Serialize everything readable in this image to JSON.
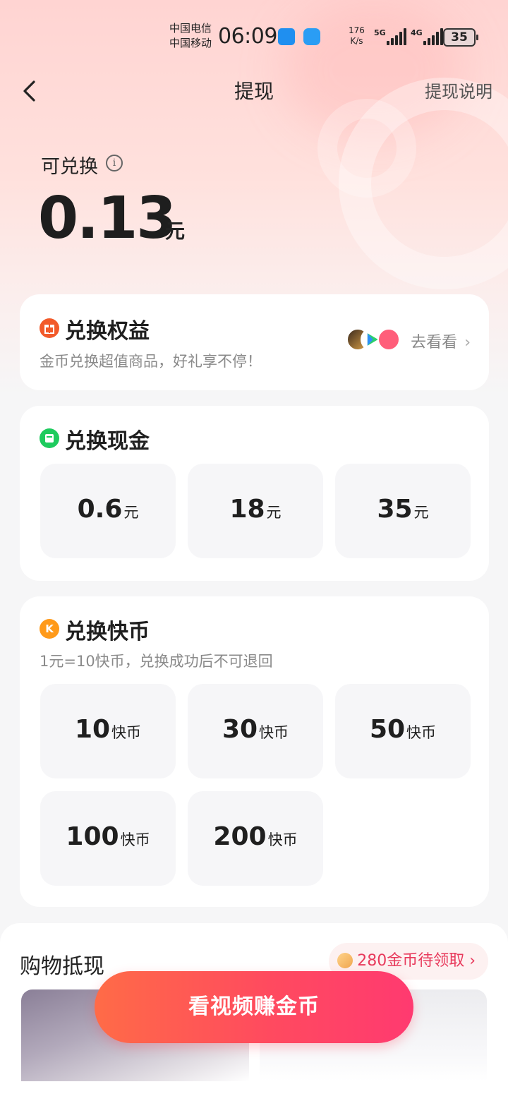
{
  "status_bar": {
    "carrier_1": "中国电信",
    "carrier_2": "中国移动",
    "time": "06:09",
    "net_speed_value": "176",
    "net_speed_unit": "K/s",
    "signal_1_label": "5G",
    "signal_2_label": "4G",
    "battery": "35"
  },
  "header": {
    "back_icon": "chevron-left-icon",
    "title": "提现",
    "help_link": "提现说明"
  },
  "balance": {
    "label": "可兑换",
    "amount": "0.13",
    "unit": "元"
  },
  "benefits_card": {
    "title": "兑换权益",
    "subtitle": "金币兑换超值商品，好礼享不停！",
    "more_label": "去看看",
    "icon": "gift-icon",
    "icon_color": "#f25a2a"
  },
  "cash_card": {
    "title": "兑换现金",
    "icon": "cash-icon",
    "icon_color": "#1ecb5e",
    "options": [
      {
        "value": "0.6",
        "unit": "元"
      },
      {
        "value": "18",
        "unit": "元"
      },
      {
        "value": "35",
        "unit": "元"
      }
    ]
  },
  "kcoin_card": {
    "title": "兑换快币",
    "subtitle": "1元=10快币，兑换成功后不可退回",
    "icon": "kcoin-icon",
    "icon_letter": "K",
    "icon_color": "#ff9a1a",
    "options": [
      {
        "value": "10",
        "unit": "快币"
      },
      {
        "value": "30",
        "unit": "快币"
      },
      {
        "value": "50",
        "unit": "快币"
      },
      {
        "value": "100",
        "unit": "快币"
      },
      {
        "value": "200",
        "unit": "快币"
      }
    ]
  },
  "shopping": {
    "title": "购物抵现",
    "pending_coins": "280金币待领取"
  },
  "cta": {
    "label": "看视频赚金币"
  },
  "colors": {
    "accent": "#ff4a5f",
    "pill_text": "#e83a5c"
  }
}
